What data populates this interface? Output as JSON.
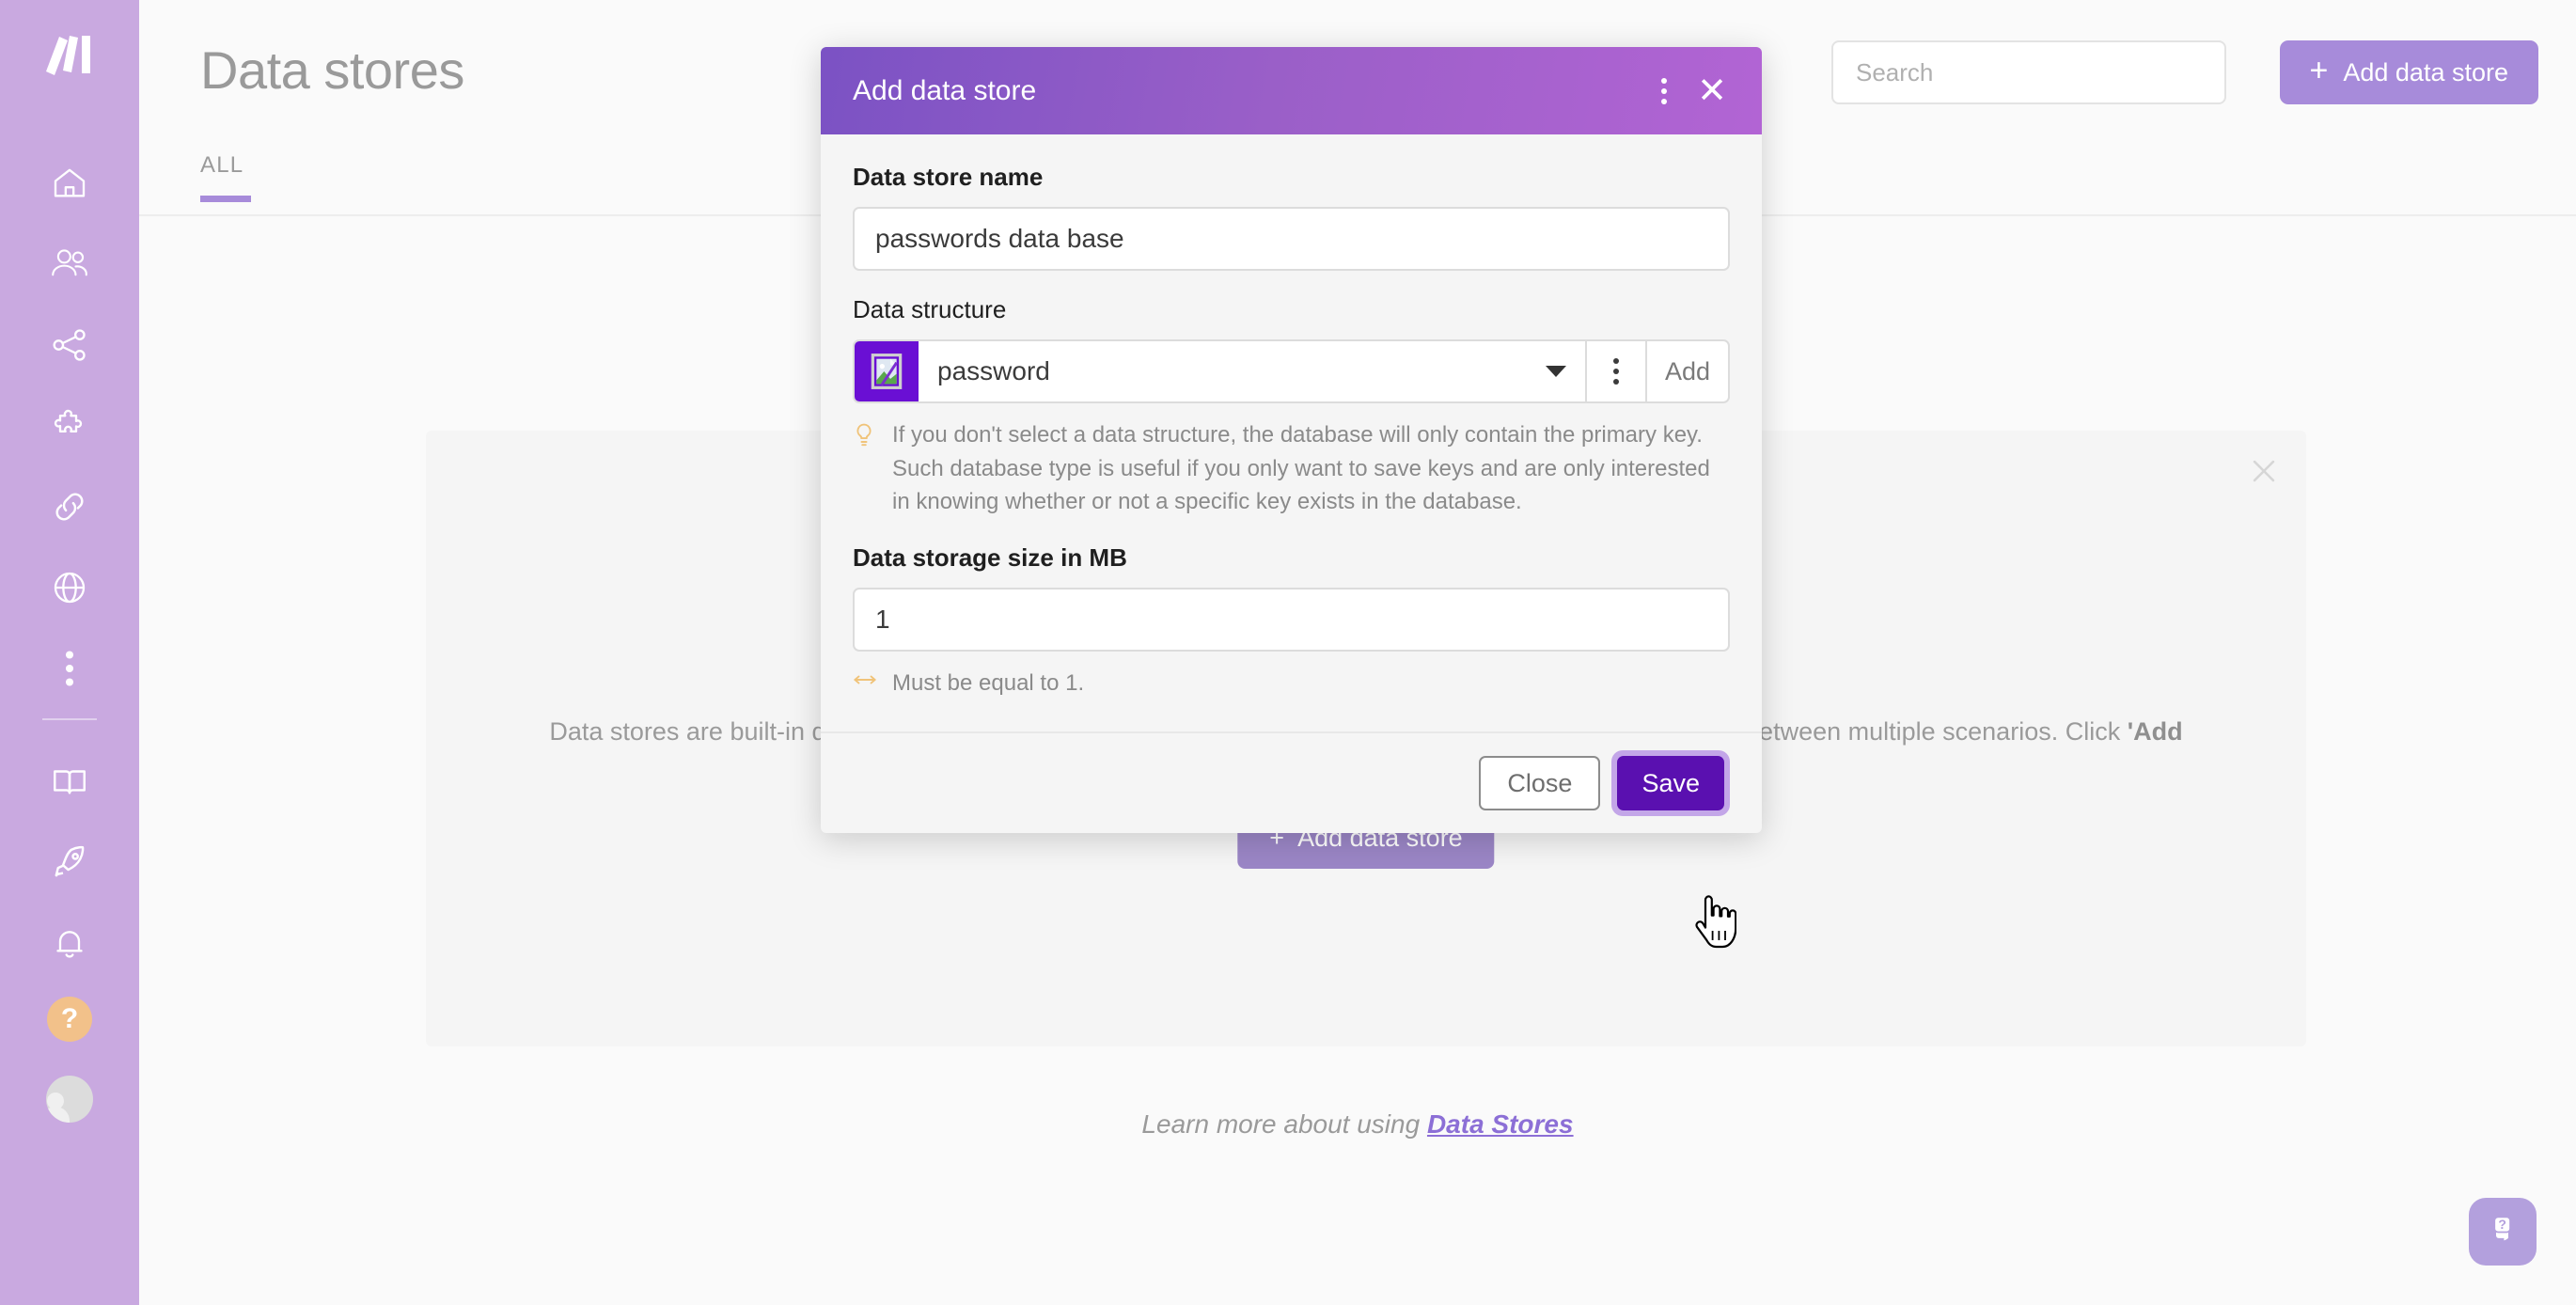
{
  "app": {
    "logo_name": "make-logo",
    "accent_purple": "#a78bda",
    "sidebar_bg": "#c9a9e0",
    "save_purple": "#5a10b0",
    "hint_amber": "#f2c68a"
  },
  "sidebar": {
    "items": [
      {
        "icon": "home-icon",
        "label": "Home"
      },
      {
        "icon": "team-icon",
        "label": "Team"
      },
      {
        "icon": "share-icon",
        "label": "Scenarios"
      },
      {
        "icon": "puzzle-icon",
        "label": "Templates"
      },
      {
        "icon": "link-icon",
        "label": "Connections"
      },
      {
        "icon": "globe-icon",
        "label": "Webhooks"
      },
      {
        "icon": "more-vertical-icon",
        "label": "More"
      }
    ],
    "secondary_items": [
      {
        "icon": "book-icon",
        "label": "Documentation"
      },
      {
        "icon": "rocket-icon",
        "label": "What's new"
      },
      {
        "icon": "bell-icon",
        "label": "Notifications"
      }
    ],
    "help_label": "?",
    "help_icon": "question-mark-icon",
    "avatar_icon": "user-avatar"
  },
  "header": {
    "title": "Data stores",
    "tabs": [
      {
        "label": "ALL",
        "active": true
      }
    ],
    "search": {
      "placeholder": "Search",
      "value": ""
    },
    "add_button": {
      "label": "Add data store",
      "icon": "plus-icon"
    }
  },
  "empty_state": {
    "close_icon": "close-icon",
    "description_prefix": "Data stores are built-in da",
    "description_suffix": "o between multiple scenarios. Click ",
    "description_bold": "'Add",
    "button_label": "Add data store",
    "button_icon": "plus-icon"
  },
  "footer": {
    "learn_more_prefix": "Learn more about using ",
    "learn_more_link": "Data Stores"
  },
  "chat_widget": {
    "icon": "help-chat-icon"
  },
  "modal": {
    "title": "Add data store",
    "kebab_icon": "more-vertical-icon",
    "close_icon": "close-icon",
    "fields": {
      "name": {
        "label": "Data store name",
        "value": "passwords data base",
        "placeholder": ""
      },
      "structure": {
        "label": "Data structure",
        "value": "password",
        "icon": "broken-image-icon",
        "caret_icon": "chevron-down-icon",
        "kebab_icon": "more-vertical-icon",
        "add_label": "Add",
        "hint_icon": "lightbulb-icon",
        "hint": "If you don't select a data structure, the database will only contain the primary key. Such database type is useful if you only want to save keys and are only interested in knowing whether or not a specific key exists in the database."
      },
      "size": {
        "label": "Data storage size in MB",
        "value": "1",
        "hint_icon": "arrows-horizontal-icon",
        "hint": "Must be equal to 1."
      }
    },
    "buttons": {
      "close_label": "Close",
      "save_label": "Save"
    }
  },
  "cursor": {
    "icon": "pointer-hand-cursor"
  }
}
